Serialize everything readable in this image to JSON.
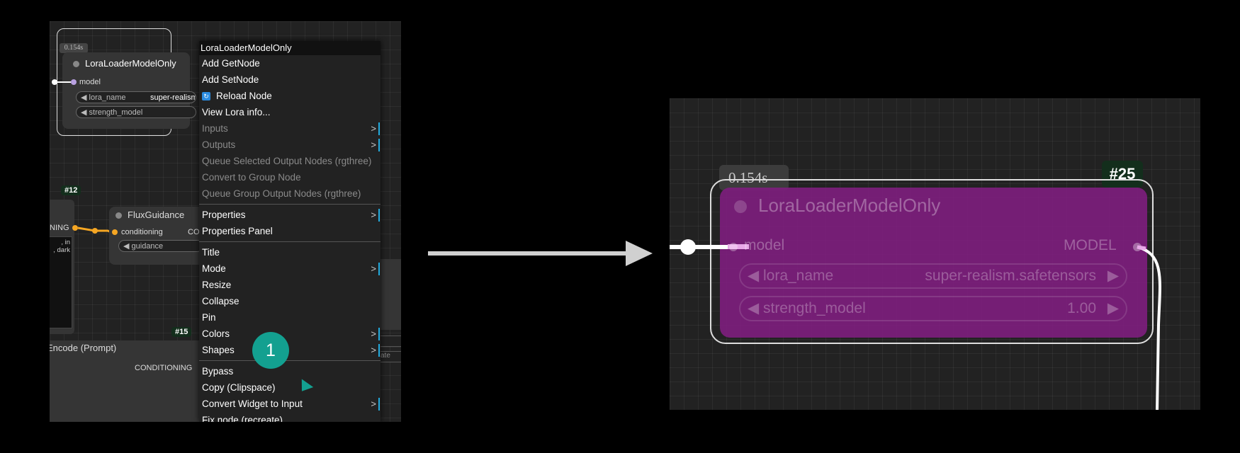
{
  "left_screen": {
    "lora_node": {
      "timing": "0.154s",
      "title": "LoraLoaderModelOnly",
      "input_label": "model",
      "widgets": [
        {
          "name": "◀ lora_name",
          "value": "super-realism"
        },
        {
          "name": "◀ strength_model",
          "value": ""
        }
      ]
    },
    "flux_node": {
      "badge": "#12",
      "title": "FluxGuidance",
      "input_label": "conditioning",
      "output_label_partial": "CO",
      "widget": "◀ guidance"
    },
    "left_node_partial": {
      "output_label": "NING",
      "text_lines": [
        ", in",
        ", dark"
      ]
    },
    "bottom_node": {
      "badge": "#15",
      "title": "Encode (Prompt)",
      "output_label": "CONDITIONING"
    },
    "right_partial": {
      "value": "7",
      "placeholder": "ate"
    }
  },
  "context_menu": {
    "title": "LoraLoaderModelOnly",
    "items": [
      {
        "label": "Add GetNode",
        "disabled": false,
        "submenu": false
      },
      {
        "label": "Add SetNode",
        "disabled": false,
        "submenu": false
      },
      {
        "label": "Reload Node",
        "disabled": false,
        "submenu": false,
        "icon": "reload-icon"
      },
      {
        "label": "View Lora info...",
        "disabled": false,
        "submenu": false
      },
      {
        "label": "Inputs",
        "disabled": true,
        "submenu": true
      },
      {
        "label": "Outputs",
        "disabled": true,
        "submenu": true
      },
      {
        "label": "Queue Selected Output Nodes (rgthree)",
        "disabled": true,
        "submenu": false
      },
      {
        "label": "Convert to Group Node",
        "disabled": true,
        "submenu": false
      },
      {
        "label": "Queue Group Output Nodes (rgthree)",
        "disabled": true,
        "submenu": false
      },
      {
        "label": "Properties",
        "disabled": false,
        "submenu": true
      },
      {
        "label": "Properties Panel",
        "disabled": false,
        "submenu": false
      },
      {
        "label": "Title",
        "disabled": false,
        "submenu": false
      },
      {
        "label": "Mode",
        "disabled": false,
        "submenu": true
      },
      {
        "label": "Resize",
        "disabled": false,
        "submenu": false
      },
      {
        "label": "Collapse",
        "disabled": false,
        "submenu": false
      },
      {
        "label": "Pin",
        "disabled": false,
        "submenu": false
      },
      {
        "label": "Colors",
        "disabled": false,
        "submenu": true
      },
      {
        "label": "Shapes",
        "disabled": false,
        "submenu": true
      },
      {
        "label": "Bypass",
        "disabled": false,
        "submenu": false
      },
      {
        "label": "Copy (Clipspace)",
        "disabled": false,
        "submenu": false
      },
      {
        "label": "Convert Widget to Input",
        "disabled": false,
        "submenu": true
      },
      {
        "label": "Fix node (recreate)",
        "disabled": false,
        "submenu": false
      }
    ],
    "submenu_arrow": ">"
  },
  "step_bubble": "1",
  "zoomed_node": {
    "timing": "0.154s",
    "badge": "#25",
    "title": "LoraLoaderModelOnly",
    "input_label": "model",
    "output_label": "MODEL",
    "widgets": [
      {
        "name": "◀ lora_name",
        "value": "super-realism.safetensors",
        "arrow": "▶"
      },
      {
        "name": "◀ strength_model",
        "value": "1.00",
        "arrow": "▶"
      }
    ],
    "bypass_color": "#7a1f7a"
  },
  "colors": {
    "canvas": "#222222",
    "menu_accent": "#22aadd",
    "bubble": "#13a090",
    "orange_link": "#f5a623"
  }
}
